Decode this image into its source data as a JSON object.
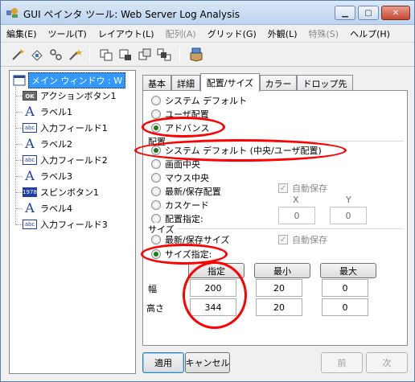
{
  "window": {
    "title": "GUI ペインタ ツール: Web Server Log Analysis",
    "minimize_label": "▁",
    "maximize_label": "▢",
    "close_label": "✕"
  },
  "menu": [
    {
      "label": "編集(E)",
      "disabled": false
    },
    {
      "label": "ツール(T)",
      "disabled": false
    },
    {
      "label": "レイアウト(L)",
      "disabled": false
    },
    {
      "label": "配列(A)",
      "disabled": true
    },
    {
      "label": "グリッド(G)",
      "disabled": false
    },
    {
      "label": "外観(L)",
      "disabled": false
    },
    {
      "label": "特殊(S)",
      "disabled": true
    },
    {
      "label": "ヘルプ(H)",
      "disabled": false
    }
  ],
  "toolbar": {
    "icons": [
      "wand-icon",
      "paint-icon",
      "tools-icon",
      "magic-icon",
      "copy-window-icon",
      "paste-window-icon",
      "duplicate-window-icon",
      "arrange-window-icon",
      "package-icon"
    ]
  },
  "tree": {
    "root": "メイン ウィンドウ : W",
    "items": [
      {
        "label": "アクションボタン1",
        "icon": "ok-button-icon",
        "glyph": "OK"
      },
      {
        "label": "ラベル1",
        "icon": "label-icon",
        "glyph": "A"
      },
      {
        "label": "入力フィールド1",
        "icon": "input-field-icon",
        "glyph": "abc"
      },
      {
        "label": "ラベル2",
        "icon": "label-icon",
        "glyph": "A"
      },
      {
        "label": "入力フィールド2",
        "icon": "input-field-icon",
        "glyph": "abc"
      },
      {
        "label": "ラベル3",
        "icon": "label-icon",
        "glyph": "A"
      },
      {
        "label": "スピンボタン1",
        "icon": "spin-button-icon",
        "glyph": "1978"
      },
      {
        "label": "ラベル4",
        "icon": "label-icon",
        "glyph": "A"
      },
      {
        "label": "入力フィールド3",
        "icon": "input-field-icon",
        "glyph": "abc"
      }
    ]
  },
  "tabs": [
    "基本",
    "詳細",
    "配置/サイズ",
    "カラー",
    "ドロップ先"
  ],
  "active_tab": 2,
  "layout_section": {
    "options": [
      "システム デフォルト",
      "ユーザ配置",
      "アドバンス"
    ],
    "selected": 2
  },
  "placement": {
    "label": "配置",
    "options": [
      "システム デフォルト (中央/ユーザ配置)",
      "画面中央",
      "マウス中央",
      "最新/保存配置",
      "カスケード",
      "配置指定:"
    ],
    "selected": 0,
    "autosave_label": "自動保存",
    "x_label": "X",
    "y_label": "Y",
    "x_value": "0",
    "y_value": "0"
  },
  "size": {
    "label": "サイズ",
    "options": [
      "最新/保存サイズ",
      "サイズ指定:"
    ],
    "selected": 1,
    "autosave_label": "自動保存",
    "col_specified": "指定",
    "col_min": "最小",
    "col_max": "最大",
    "row_width": "幅",
    "row_height": "高さ",
    "width_specified": "200",
    "width_min": "20",
    "width_max": "0",
    "height_specified": "344",
    "height_min": "20",
    "height_max": "0"
  },
  "buttons": {
    "apply": "適用",
    "cancel": "キャンセル",
    "prev": "前",
    "next": "次"
  },
  "colors": {
    "selection": "#3399ff",
    "annotation": "#ff0000",
    "titlebar": "#c9dcf1"
  }
}
